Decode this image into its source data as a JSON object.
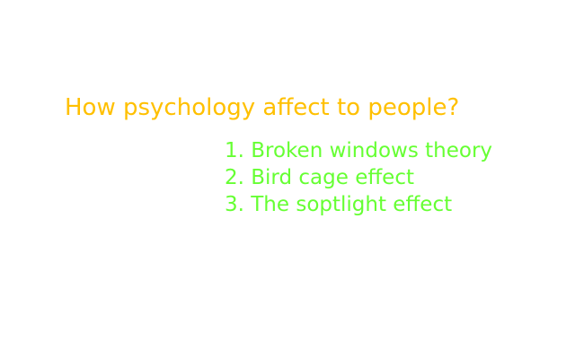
{
  "slide": {
    "title": "How psychology affect to people?",
    "items": [
      "1. Broken windows theory",
      "2. Bird cage effect",
      "3. The soptlight effect"
    ]
  },
  "colors": {
    "background": "#ffffff",
    "title": "#ffc000",
    "list": "#66ff33"
  }
}
